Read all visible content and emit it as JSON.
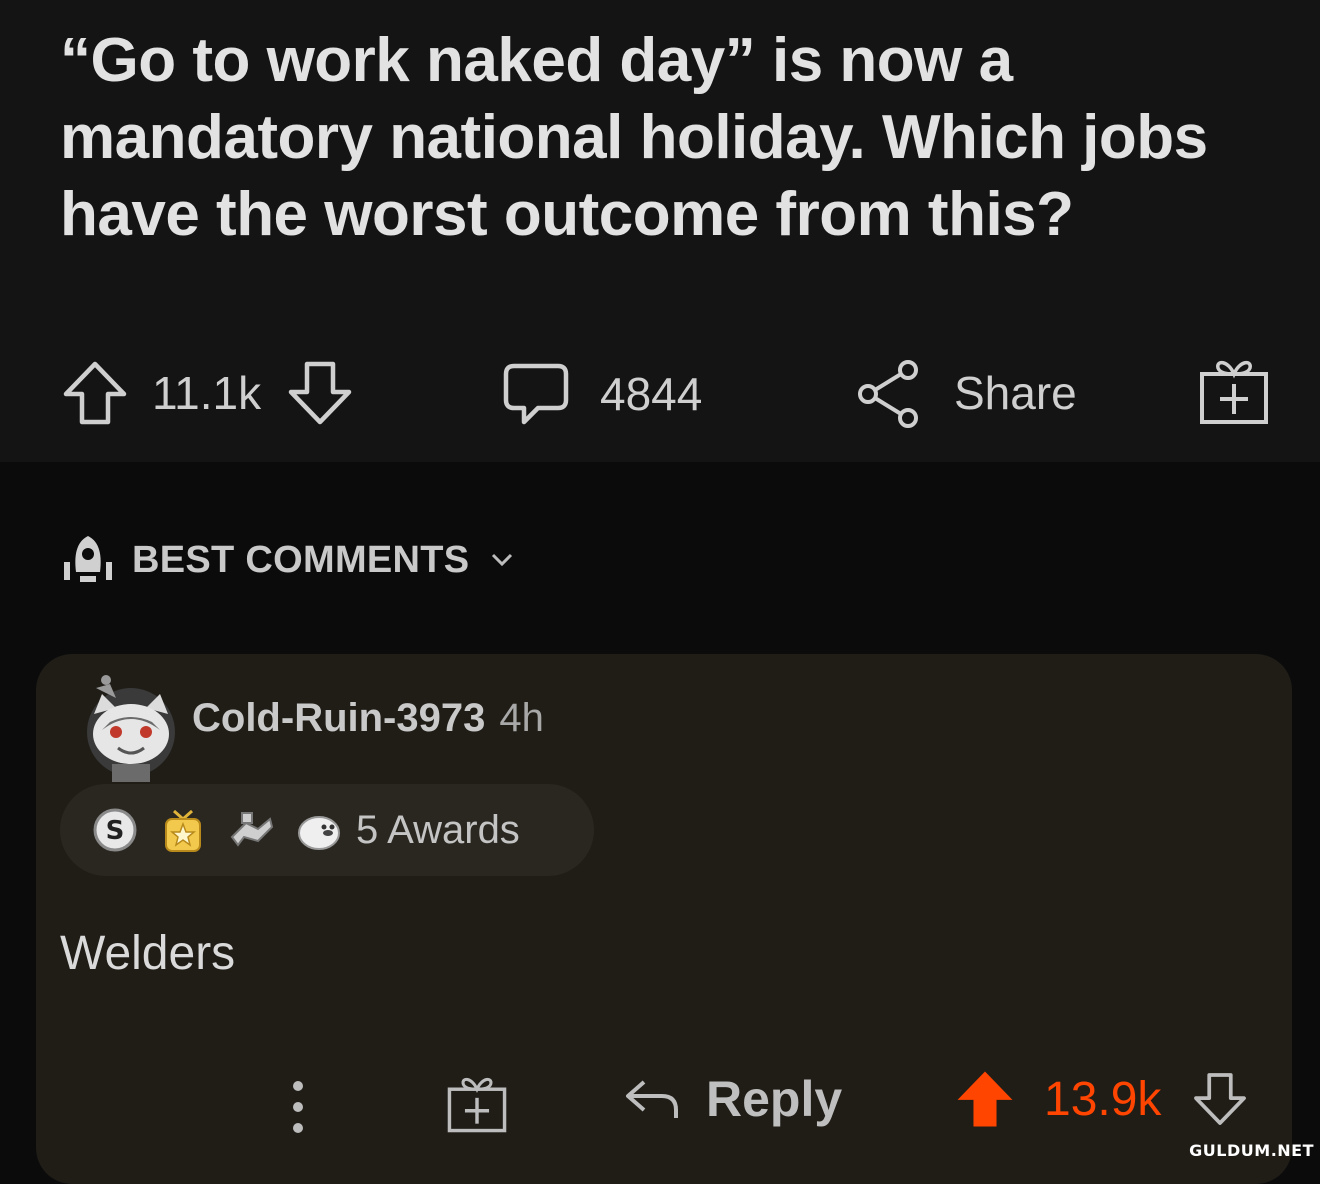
{
  "post": {
    "title": "“Go to work naked day” is now a mandatory national holiday. Which jobs have the worst outcome from this?",
    "score": "11.1k",
    "comments_count": "4844",
    "share_label": "Share",
    "icons": {
      "upvote": "arrow-up-outline-icon",
      "downvote": "arrow-down-outline-icon",
      "comments": "speech-bubble-icon",
      "share": "share-nodes-icon",
      "award": "gift-icon"
    }
  },
  "sort": {
    "label": "BEST COMMENTS",
    "icon": "rocket-icon",
    "chevron": "chevron-down-icon"
  },
  "comment": {
    "author": "Cold-Ruin-3973",
    "time": "4h",
    "awards_label": "5 Awards",
    "awards": [
      "silver-coin-icon",
      "gold-star-medal-icon",
      "handshake-icon",
      "seal-icon"
    ],
    "body": "Welders",
    "reply_label": "Reply",
    "score": "13.9k",
    "upvote_color": "#ff4500"
  },
  "watermark": "GULDUM.NET",
  "colors": {
    "background": "#0b0b0c",
    "post_background": "#141414",
    "card_background": "#201d17",
    "accent": "#ff4500"
  }
}
